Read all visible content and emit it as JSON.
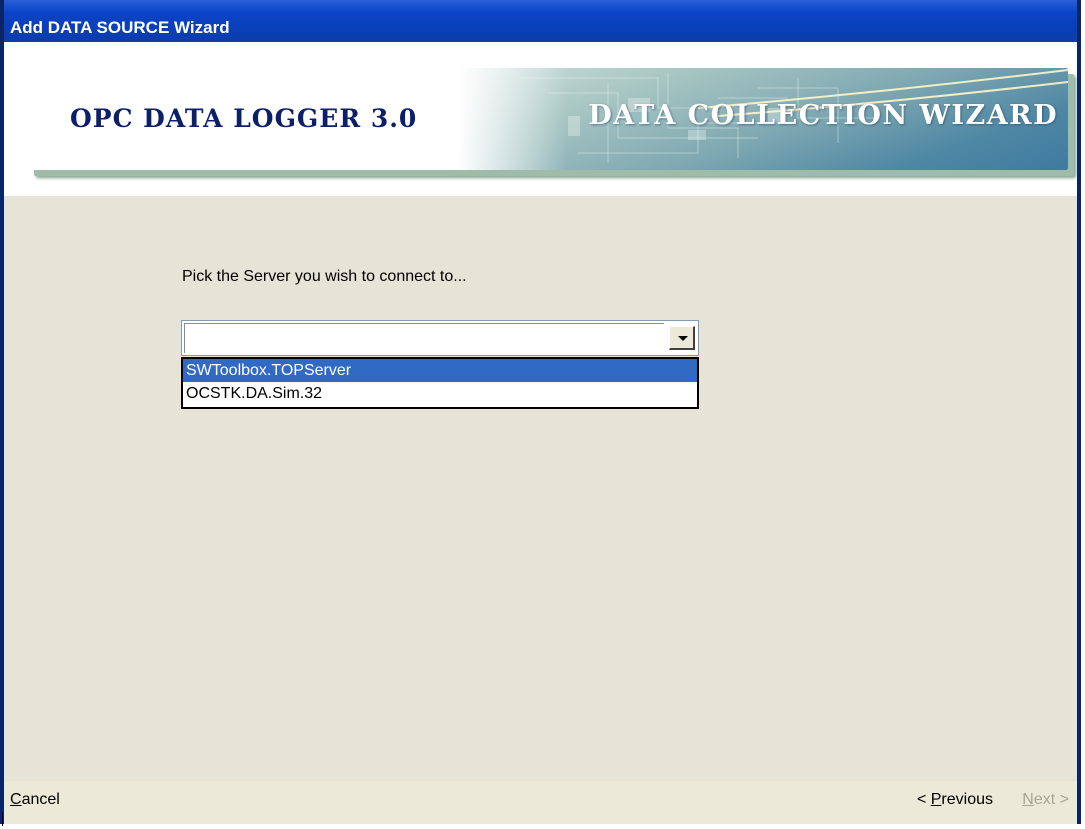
{
  "window": {
    "title": "Add DATA SOURCE Wizard"
  },
  "banner": {
    "left_text": "OPC DATA LOGGER 3.0",
    "right_text": "DATA COLLECTION WIZARD"
  },
  "main": {
    "prompt": "Pick the Server you wish to connect to...",
    "server_combo": {
      "value": "",
      "options": [
        {
          "label": "SWToolbox.TOPServer",
          "selected": true
        },
        {
          "label": "OCSTK.DA.Sim.32",
          "selected": false
        }
      ]
    }
  },
  "footer": {
    "cancel_prefix": "",
    "cancel_accel": "C",
    "cancel_rest": "ancel",
    "previous_prefix": "< ",
    "previous_accel": "P",
    "previous_rest": "revious",
    "next_prefix": "",
    "next_accel": "N",
    "next_rest": "ext >",
    "next_enabled": false
  },
  "colors": {
    "titlebar": "#0a43c6",
    "selection": "#316ac5",
    "dialog_background": "#e5e4d6",
    "banner_text": "#0c1f6b",
    "disabled_text": "#a7a594"
  }
}
